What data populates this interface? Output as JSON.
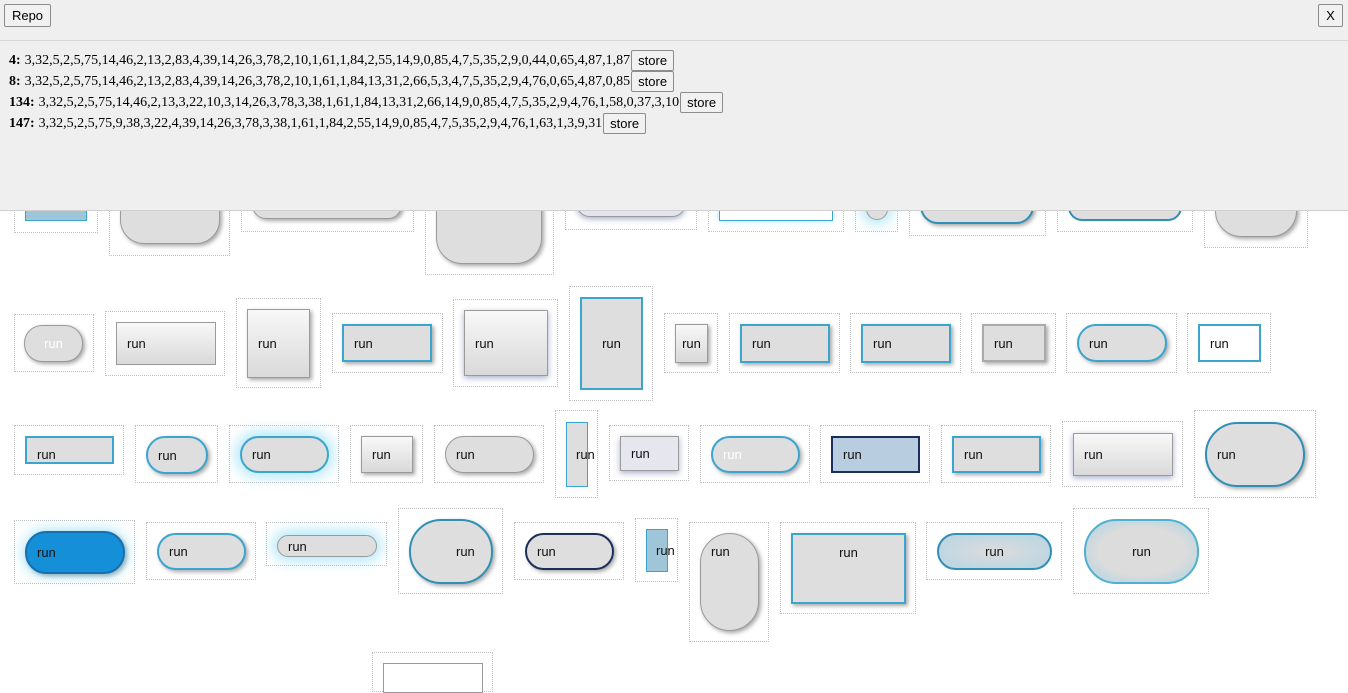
{
  "repo_panel": {
    "repo_button": "Repo",
    "close_button": "X",
    "entries": [
      {
        "id": "4:",
        "sequence": "3,32,5,2,5,75,14,46,2,13,2,83,4,39,14,26,3,78,2,10,1,61,1,84,2,55,14,9,0,85,4,7,5,35,2,9,0,44,0,65,4,87,1,87",
        "store_label": "store"
      },
      {
        "id": "8:",
        "sequence": "3,32,5,2,5,75,14,46,2,13,2,83,4,39,14,26,3,78,2,10,1,61,1,84,13,31,2,66,5,3,4,7,5,35,2,9,4,76,0,65,4,87,0,85",
        "store_label": "store"
      },
      {
        "id": "134:",
        "sequence": "3,32,5,2,5,75,14,46,2,13,3,22,10,3,14,26,3,78,3,38,1,61,1,84,13,31,2,66,14,9,0,85,4,7,5,35,2,9,4,76,1,58,0,37,3,10",
        "store_label": "store"
      },
      {
        "id": "147:",
        "sequence": "3,32,5,2,5,75,9,38,3,22,4,39,14,26,3,78,3,38,1,61,1,84,2,55,14,9,0,85,4,7,5,35,2,9,4,76,1,63,1,3,9,31",
        "store_label": "store"
      }
    ]
  },
  "button_label": "run"
}
